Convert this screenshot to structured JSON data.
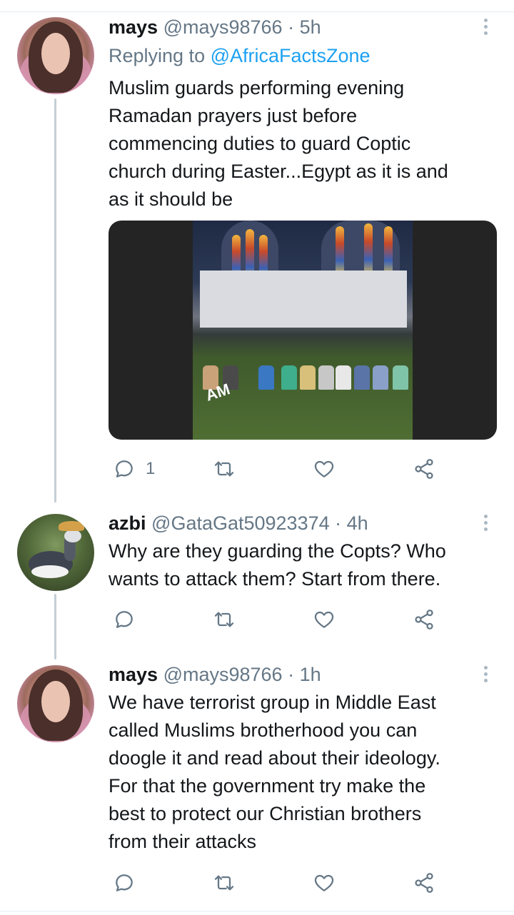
{
  "tweets": [
    {
      "name": "mays",
      "handle": "@mays98766",
      "time": "· 5h",
      "reply_prefix": "Replying to ",
      "reply_to": "@AfricaFactsZone",
      "text_lines": [
        "Muslim guards performing evening",
        "Ramadan prayers just before",
        "commencing duties to guard Coptic",
        "church during Easter...Egypt as it is and",
        "as it should be"
      ],
      "media_watermark": "AM",
      "reply_count": "1"
    },
    {
      "name": "azbi",
      "handle": "@GataGat50923374",
      "time": "· 4h",
      "text_lines": [
        "Why are they guarding the Copts? Who",
        "wants to attack them? Start from there."
      ]
    },
    {
      "name": "mays",
      "handle": "@mays98766",
      "time": "· 1h",
      "text_lines": [
        "We have terrorist group in Middle East",
        "called Muslims brotherhood you can",
        "doogle it and read about their ideology.",
        "For that the government try make the",
        "best to protect our Christian brothers",
        "from their attacks"
      ]
    }
  ],
  "icons": {
    "reply": "reply-icon",
    "retweet": "retweet-icon",
    "like": "heart-icon",
    "share": "share-icon",
    "more": "more-vertical-icon"
  },
  "colors": {
    "link": "#1da1f2",
    "secondary_text": "#657786",
    "thread_line": "#c4cfd6"
  }
}
